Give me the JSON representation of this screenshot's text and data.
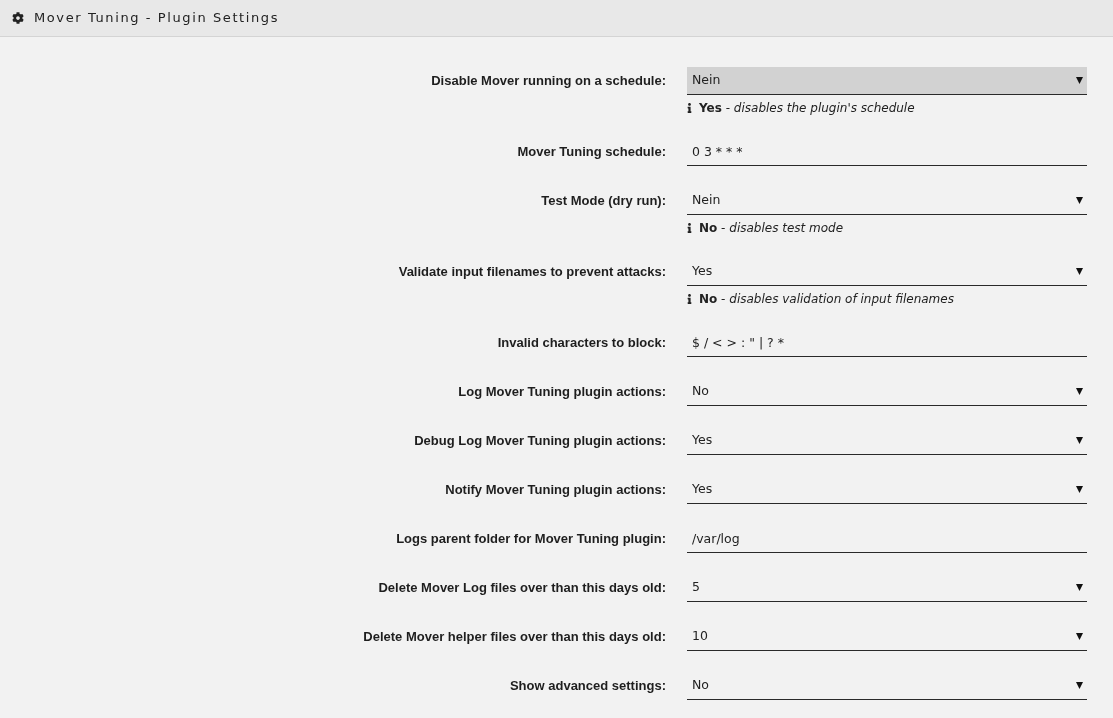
{
  "panel": {
    "title": "Mover Tuning - Plugin Settings"
  },
  "settings": [
    {
      "label": "Disable Mover running on a schedule:",
      "kind": "select",
      "value": "Nein",
      "highlighted": true,
      "help": "**Yes** - *disables the plugin's schedule*"
    },
    {
      "label": "Mover Tuning schedule:",
      "kind": "text",
      "value": "0 3 * * *",
      "highlighted": false
    },
    {
      "label": "Test Mode (dry run):",
      "kind": "select",
      "value": "Nein",
      "highlighted": false,
      "help": "**No** - *disables test mode*"
    },
    {
      "label": "Validate input filenames to prevent attacks:",
      "kind": "select",
      "value": "Yes",
      "highlighted": false,
      "help": "**No** - *disables validation of input filenames*"
    },
    {
      "label": "Invalid characters to block:",
      "kind": "text",
      "value": "$ / < > : \" | ? *",
      "highlighted": false
    },
    {
      "label": "Log Mover Tuning plugin actions:",
      "kind": "select",
      "value": "No",
      "highlighted": false
    },
    {
      "label": "Debug Log Mover Tuning plugin actions:",
      "kind": "select",
      "value": "Yes",
      "highlighted": false
    },
    {
      "label": "Notify Mover Tuning plugin actions:",
      "kind": "select",
      "value": "Yes",
      "highlighted": false
    },
    {
      "label": "Logs parent folder for Mover Tuning plugin:",
      "kind": "text",
      "value": "/var/log",
      "highlighted": false
    },
    {
      "label": "Delete Mover Log files over than this days old:",
      "kind": "select",
      "value": "5",
      "highlighted": false
    },
    {
      "label": "Delete Mover helper files over than this days old:",
      "kind": "select",
      "value": "10",
      "highlighted": false
    },
    {
      "label": "Show advanced settings:",
      "kind": "select",
      "value": "No",
      "highlighted": false
    }
  ]
}
